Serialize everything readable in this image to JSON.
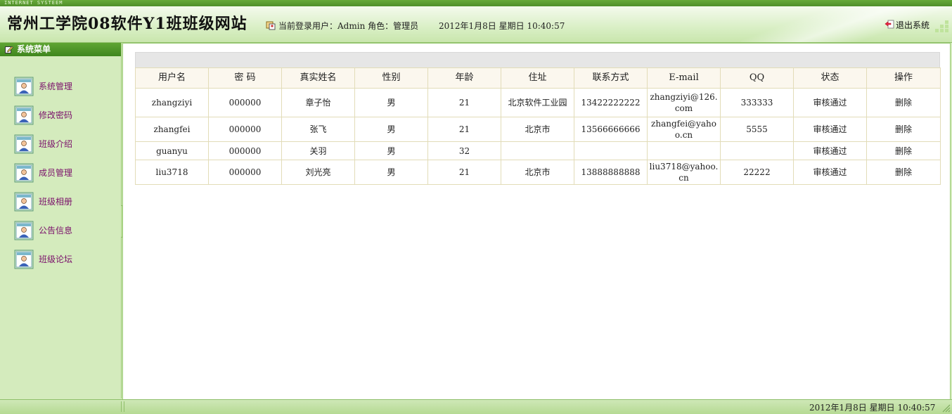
{
  "top_strip": {
    "text": "INTERNET SYSTEEM"
  },
  "header": {
    "site_title": "常州工学院08软件Y1班班级网站",
    "login_info": "当前登录用户：Admin 角色：管理员",
    "datetime": "2012年1月8日  星期日  10:40:57",
    "logout_label": "退出系统"
  },
  "sidebar": {
    "title": "系统菜单",
    "items": [
      {
        "label": "系统管理",
        "icon": "user-card-icon"
      },
      {
        "label": "修改密码",
        "icon": "user-card-icon"
      },
      {
        "label": "班级介绍",
        "icon": "user-card-icon"
      },
      {
        "label": "成员管理",
        "icon": "user-card-icon"
      },
      {
        "label": "班级相册",
        "icon": "user-card-icon"
      },
      {
        "label": "公告信息",
        "icon": "user-card-icon"
      },
      {
        "label": "班级论坛",
        "icon": "user-card-icon"
      }
    ]
  },
  "table": {
    "columns": [
      "用户名",
      "密  码",
      "真实姓名",
      "性别",
      "年龄",
      "住址",
      "联系方式",
      "E-mail",
      "QQ",
      "状态",
      "操作"
    ],
    "rows": [
      [
        "zhangziyi",
        "000000",
        "章子怡",
        "男",
        "21",
        "北京软件工业园",
        "13422222222",
        "zhangziyi@126.com",
        "333333",
        "审核通过",
        "删除"
      ],
      [
        "zhangfei",
        "000000",
        "张飞",
        "男",
        "21",
        "北京市",
        "13566666666",
        "zhangfei@yahoo.cn",
        "5555",
        "审核通过",
        "删除"
      ],
      [
        "guanyu",
        "000000",
        "关羽",
        "男",
        "32",
        "",
        "",
        "",
        "",
        "审核通过",
        "删除"
      ],
      [
        "liu3718",
        "000000",
        "刘光亮",
        "男",
        "21",
        "北京市",
        "13888888888",
        "liu3718@yahoo.cn",
        "22222",
        "审核通过",
        "删除"
      ]
    ]
  },
  "footer": {
    "datetime": "2012年1月8日  星期日  10:40:57"
  },
  "colors": {
    "accent_green": "#4f8e2a",
    "sidebar_bg": "#d4ebbd",
    "menu_text": "#7a0f6a"
  }
}
